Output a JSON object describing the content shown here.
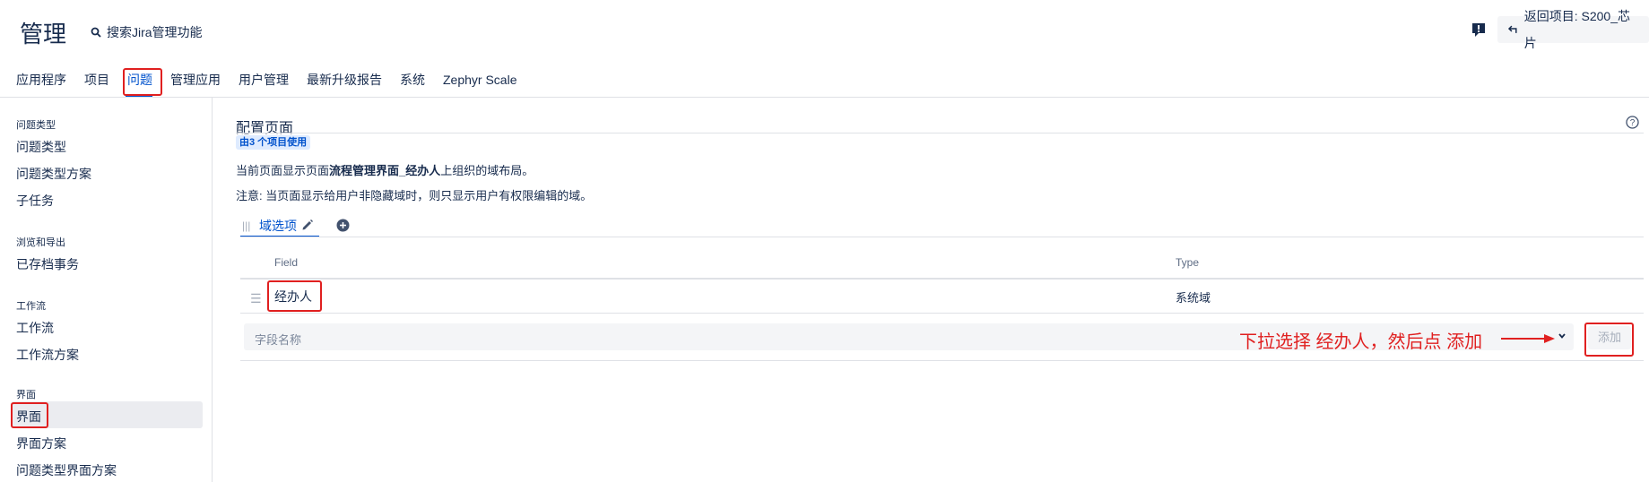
{
  "header": {
    "title": "管理",
    "search_label": "搜索Jira管理功能",
    "back_button_label": "返回项目: S200_芯片"
  },
  "nav": {
    "items": [
      "应用程序",
      "项目",
      "问题",
      "管理应用",
      "用户管理",
      "最新升级报告",
      "系统",
      "Zephyr Scale"
    ],
    "active": "问题"
  },
  "sidebar": {
    "sections": [
      {
        "heading": "问题类型",
        "items": [
          "问题类型",
          "问题类型方案",
          "子任务"
        ]
      },
      {
        "heading": "浏览和导出",
        "items": [
          "已存档事务"
        ]
      },
      {
        "heading": "工作流",
        "items": [
          "工作流",
          "工作流方案"
        ]
      },
      {
        "heading": "界面",
        "items": [
          "界面",
          "界面方案",
          "问题类型界面方案"
        ]
      }
    ],
    "selected": "界面"
  },
  "main": {
    "title": "配置页面",
    "usage_badge": "由3 个项目使用",
    "desc_prefix": "当前页面显示页面",
    "desc_screen_name": "流程管理界面_经办人",
    "desc_suffix": "上组织的域布局。",
    "note": "注意: 当页面显示给用户非隐藏域时，则只显示用户有权限编辑的域。",
    "tab_label": "域选项",
    "columns": {
      "field": "Field",
      "type": "Type"
    },
    "rows": [
      {
        "field": "经办人",
        "type": "系统域"
      }
    ],
    "field_select_placeholder": "字段名称",
    "add_button": "添加"
  },
  "annotation": {
    "text": "下拉选择 经办人，然后点 添加",
    "color": "#e02020"
  },
  "colors": {
    "accent": "#0052cc",
    "highlight_box": "#e02020"
  }
}
